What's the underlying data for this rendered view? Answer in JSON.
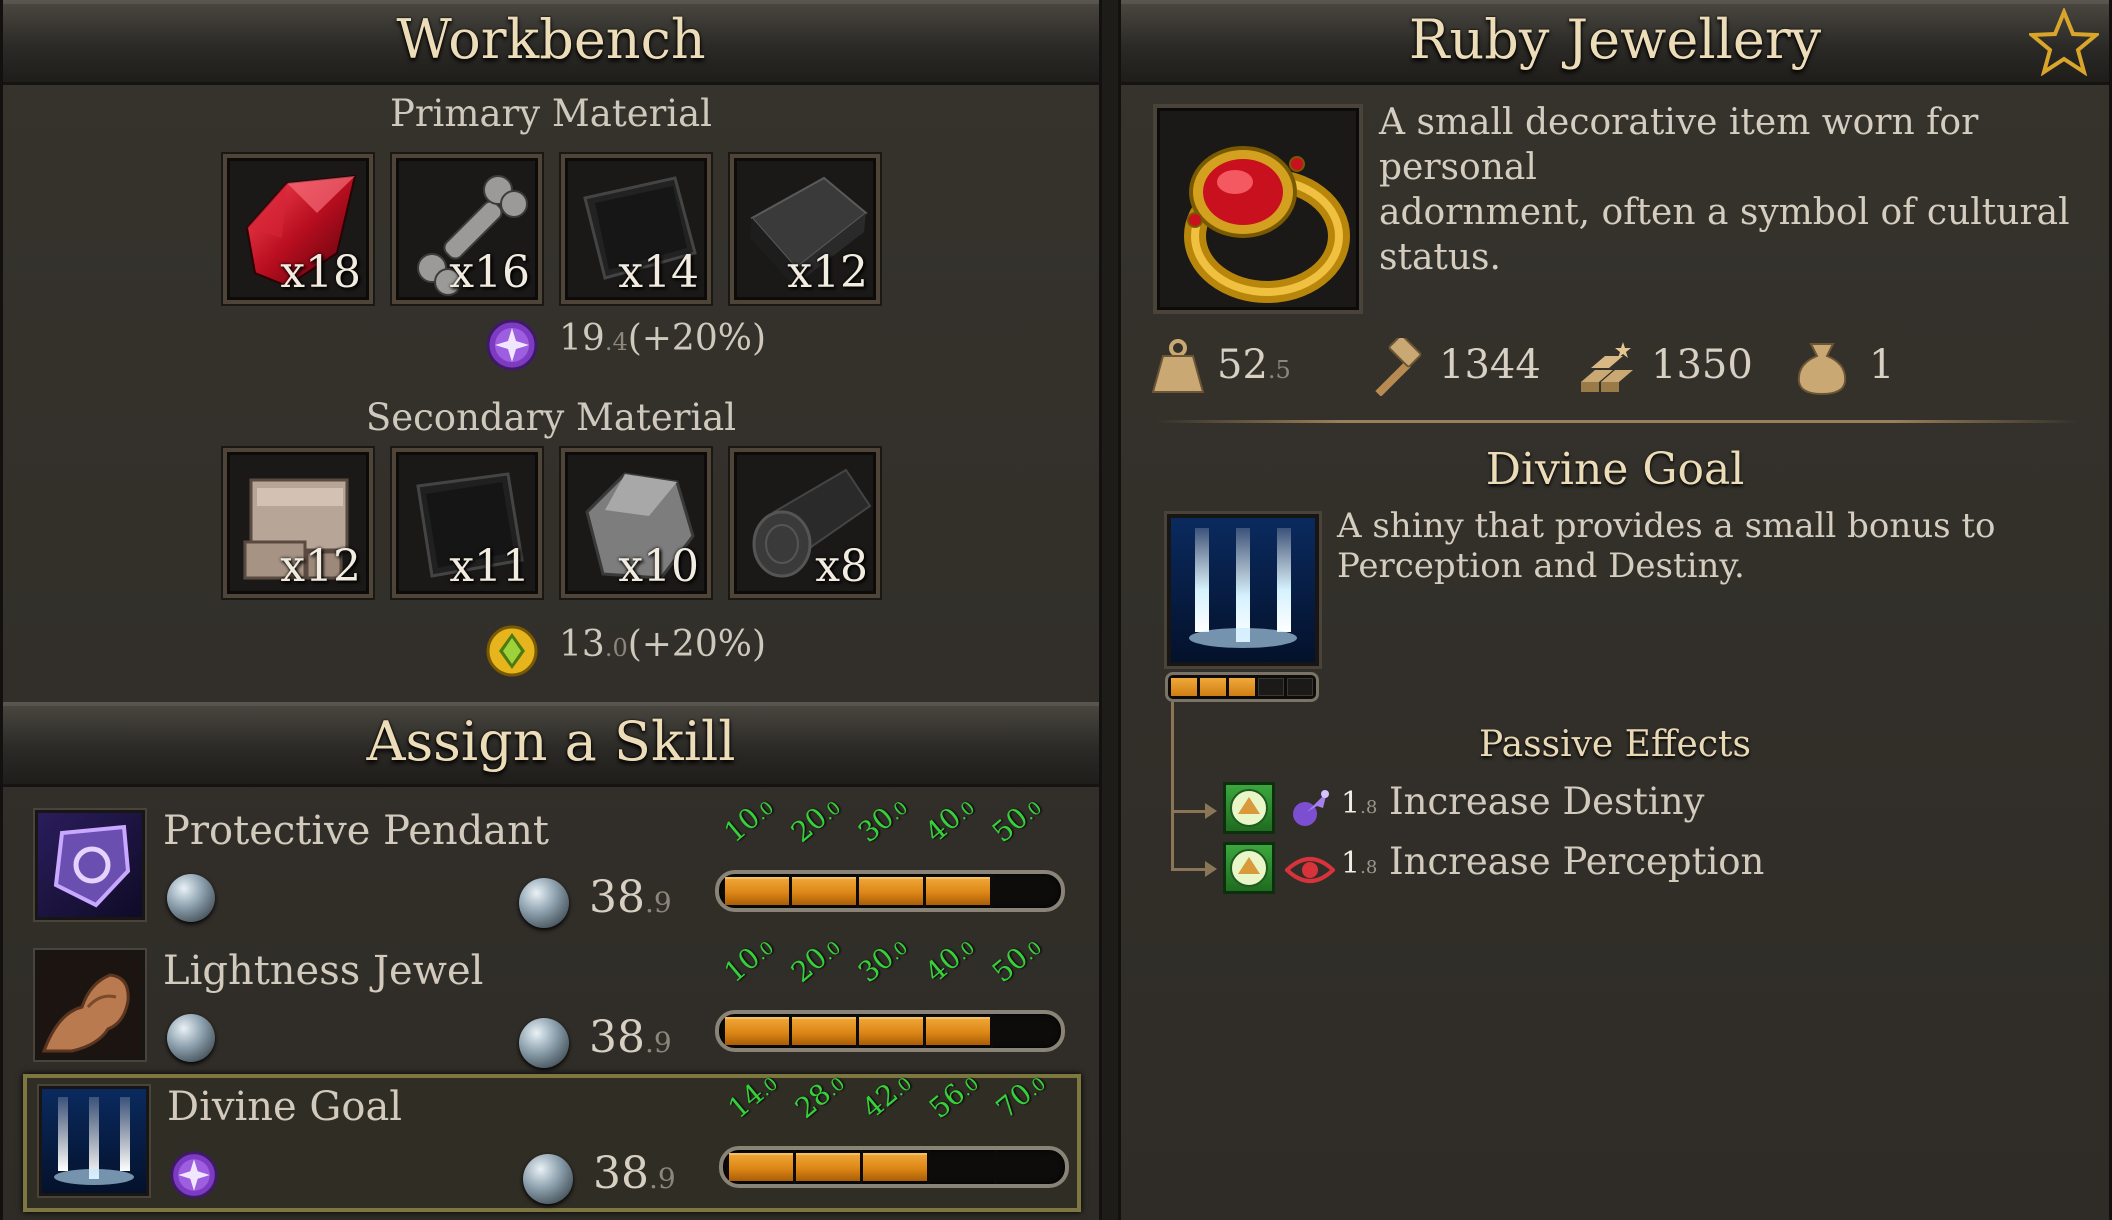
{
  "workbench": {
    "title": "Workbench",
    "primary": {
      "label": "Primary Material",
      "items": [
        {
          "name": "ruby",
          "qty": "x18"
        },
        {
          "name": "bone",
          "qty": "x16"
        },
        {
          "name": "dark-leather",
          "qty": "x14"
        },
        {
          "name": "iron-bar",
          "qty": "x12"
        }
      ],
      "stat_int": "19",
      "stat_dec": ".4",
      "stat_bonus": "(+20%)",
      "stat_icon": "purple-star-gem-icon"
    },
    "secondary": {
      "label": "Secondary Material",
      "items": [
        {
          "name": "stone-blocks",
          "qty": "x12"
        },
        {
          "name": "black-leather",
          "qty": "x11"
        },
        {
          "name": "stone",
          "qty": "x10"
        },
        {
          "name": "log",
          "qty": "x8"
        }
      ],
      "stat_int": "13",
      "stat_dec": ".0",
      "stat_bonus": "(+20%)",
      "stat_icon": "gold-gem-icon"
    }
  },
  "assign_skill": {
    "title": "Assign a Skill",
    "skills": [
      {
        "name": "Protective Pendant",
        "cost_int": "38",
        "cost_dec": ".9",
        "ticks": [
          [
            "10",
            ".0"
          ],
          [
            "20",
            ".0"
          ],
          [
            "30",
            ".0"
          ],
          [
            "40",
            ".0"
          ],
          [
            "50",
            ".0"
          ]
        ],
        "filled_segments": 4,
        "selected": false
      },
      {
        "name": "Lightness Jewel",
        "cost_int": "38",
        "cost_dec": ".9",
        "ticks": [
          [
            "10",
            ".0"
          ],
          [
            "20",
            ".0"
          ],
          [
            "30",
            ".0"
          ],
          [
            "40",
            ".0"
          ],
          [
            "50",
            ".0"
          ]
        ],
        "filled_segments": 4,
        "selected": false
      },
      {
        "name": "Divine Goal",
        "cost_int": "38",
        "cost_dec": ".9",
        "ticks": [
          [
            "14",
            ".0"
          ],
          [
            "28",
            ".0"
          ],
          [
            "42",
            ".0"
          ],
          [
            "56",
            ".0"
          ],
          [
            "70",
            ".0"
          ]
        ],
        "filled_segments": 3,
        "selected": true
      }
    ]
  },
  "item": {
    "title": "Ruby Jewellery",
    "description": "A small decorative item worn for personal adornment, often a symbol of cultural status.",
    "desc_lines": [
      "A small decorative item worn for personal",
      "adornment, often a symbol of cultural",
      "status."
    ],
    "stats": {
      "weight_int": "52",
      "weight_dec": ".5",
      "craft": "1344",
      "value": "1350",
      "count": "1"
    },
    "favorite_icon": "star-icon"
  },
  "skill_detail": {
    "title": "Divine Goal",
    "desc_lines": [
      "A shiny that provides a small bonus to",
      "Perception and Destiny."
    ],
    "level_segments_total": 5,
    "level_segments_filled": 3,
    "passive_title": "Passive Effects",
    "effects": [
      {
        "icon": "destiny-icon",
        "val_int": "1",
        "val_dec": ".8",
        "label": "Increase Destiny"
      },
      {
        "icon": "eye-icon",
        "val_int": "1",
        "val_dec": ".8",
        "label": "Increase Perception"
      }
    ]
  }
}
